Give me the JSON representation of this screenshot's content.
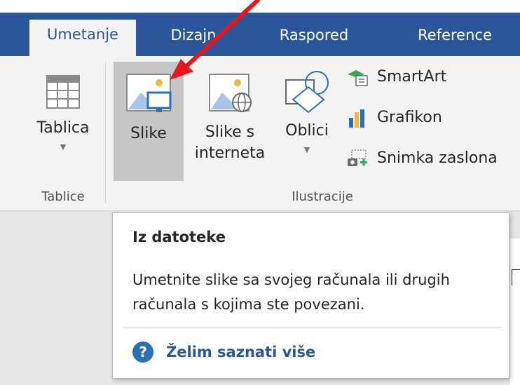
{
  "tabs": [
    {
      "label": "Umetanje",
      "active": true
    },
    {
      "label": "Dizajn",
      "active": false
    },
    {
      "label": "Raspored",
      "active": false
    },
    {
      "label": "Reference",
      "active": false
    }
  ],
  "ribbon": {
    "table_button": "Tablica",
    "pictures_button": "Slike",
    "online_pictures_line1": "Slike s",
    "online_pictures_line2": "interneta",
    "shapes_button": "Oblici",
    "smartart_button": "SmartArt",
    "chart_button": "Grafikon",
    "screenshot_button": "Snimka zaslona",
    "group_tables": "Tablice",
    "group_illustrations": "Ilustracije"
  },
  "tooltip": {
    "title": "Iz datoteke",
    "description": "Umetnite slike sa svojeg  računala ili drugih računala s kojima ste povezani.",
    "help_link": "Želim saznati više"
  },
  "colors": {
    "tab_bar": "#2b579a",
    "ribbon_bg": "#f3f3f3",
    "selected_button": "#c6c6c6",
    "annotation_arrow": "#e8161b"
  }
}
